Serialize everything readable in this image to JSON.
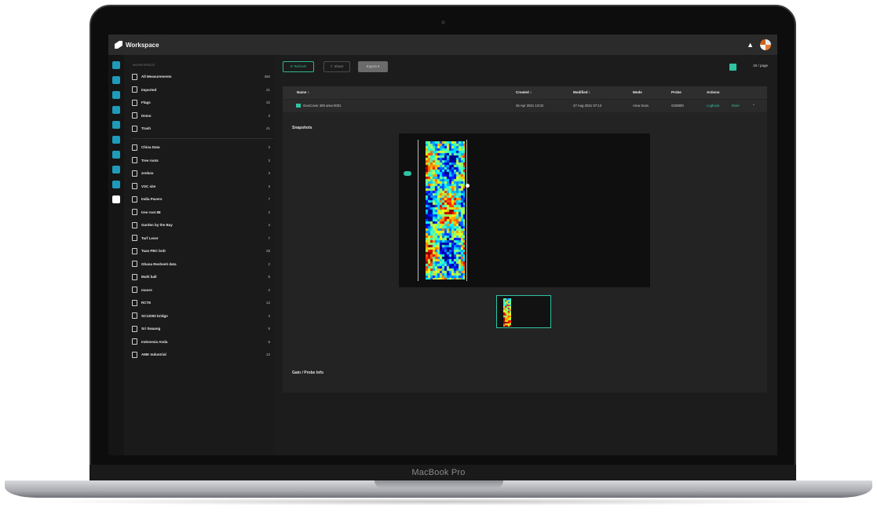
{
  "app": {
    "title": "Workspace",
    "model_label": "MacBook Pro"
  },
  "rail": {
    "items": [
      "home",
      "ms",
      "sp",
      "sp",
      "sm",
      "pd",
      "nc",
      "sf",
      "mq",
      "data"
    ]
  },
  "sidebar": {
    "group_label": "WORKSPACE",
    "top_items": [
      {
        "label": "All Measurements",
        "count": "450",
        "icon": "file-icon"
      },
      {
        "label": "Imported",
        "count": "21",
        "icon": "import-icon"
      },
      {
        "label": "Flags",
        "count": "32",
        "icon": "flag-icon"
      },
      {
        "label": "Demo",
        "count": "3",
        "icon": "folder-icon"
      },
      {
        "label": "Trash",
        "count": "41",
        "icon": "trash-icon"
      }
    ],
    "projects": [
      {
        "label": "China Data",
        "count": "3"
      },
      {
        "label": "Tree roots",
        "count": "3"
      },
      {
        "label": "zenbox",
        "count": "3"
      },
      {
        "label": "VSC site",
        "count": "3"
      },
      {
        "label": "India Pavers",
        "count": "7"
      },
      {
        "label": "tree root 88",
        "count": "3"
      },
      {
        "label": "Garden by the Bay",
        "count": "4"
      },
      {
        "label": "Turf Lever",
        "count": "7"
      },
      {
        "label": "Tuas PBC brdr",
        "count": "28"
      },
      {
        "label": "Ghana Resheeti data",
        "count": "2"
      },
      {
        "label": "Multi ball",
        "count": "5"
      },
      {
        "label": "moore",
        "count": "2"
      },
      {
        "label": "RCTE",
        "count": "12"
      },
      {
        "label": "SC12000 bridge",
        "count": "4"
      },
      {
        "label": "Sri Swaang",
        "count": "5"
      },
      {
        "label": "Indonesia Anda",
        "count": "6"
      },
      {
        "label": "AMK Industrial",
        "count": "12"
      }
    ]
  },
  "toolbar": {
    "refresh": "⟳ Refresh",
    "share": "⇪ Share",
    "export": "Export ▾",
    "page_size": "20 / page"
  },
  "table": {
    "headers": [
      "Name ↕",
      "Created ↕",
      "Modified ↕",
      "Mode",
      "Probe",
      "Actions"
    ],
    "row": {
      "name": "GeoCover 400 area 0001",
      "created": "26 Apr 2021 13:02",
      "modified": "27 Aug 2021 07:13",
      "mode": "Area Scan",
      "probe": "GS8000",
      "action_logbook": "Logbook",
      "action_more": "More"
    }
  },
  "detail": {
    "snapshots_label": "Snapshots",
    "probe_info_label": "Gain / Probe Info"
  },
  "colors": {
    "accent": "#2fc2a3",
    "rail": "#1e9bb8"
  }
}
